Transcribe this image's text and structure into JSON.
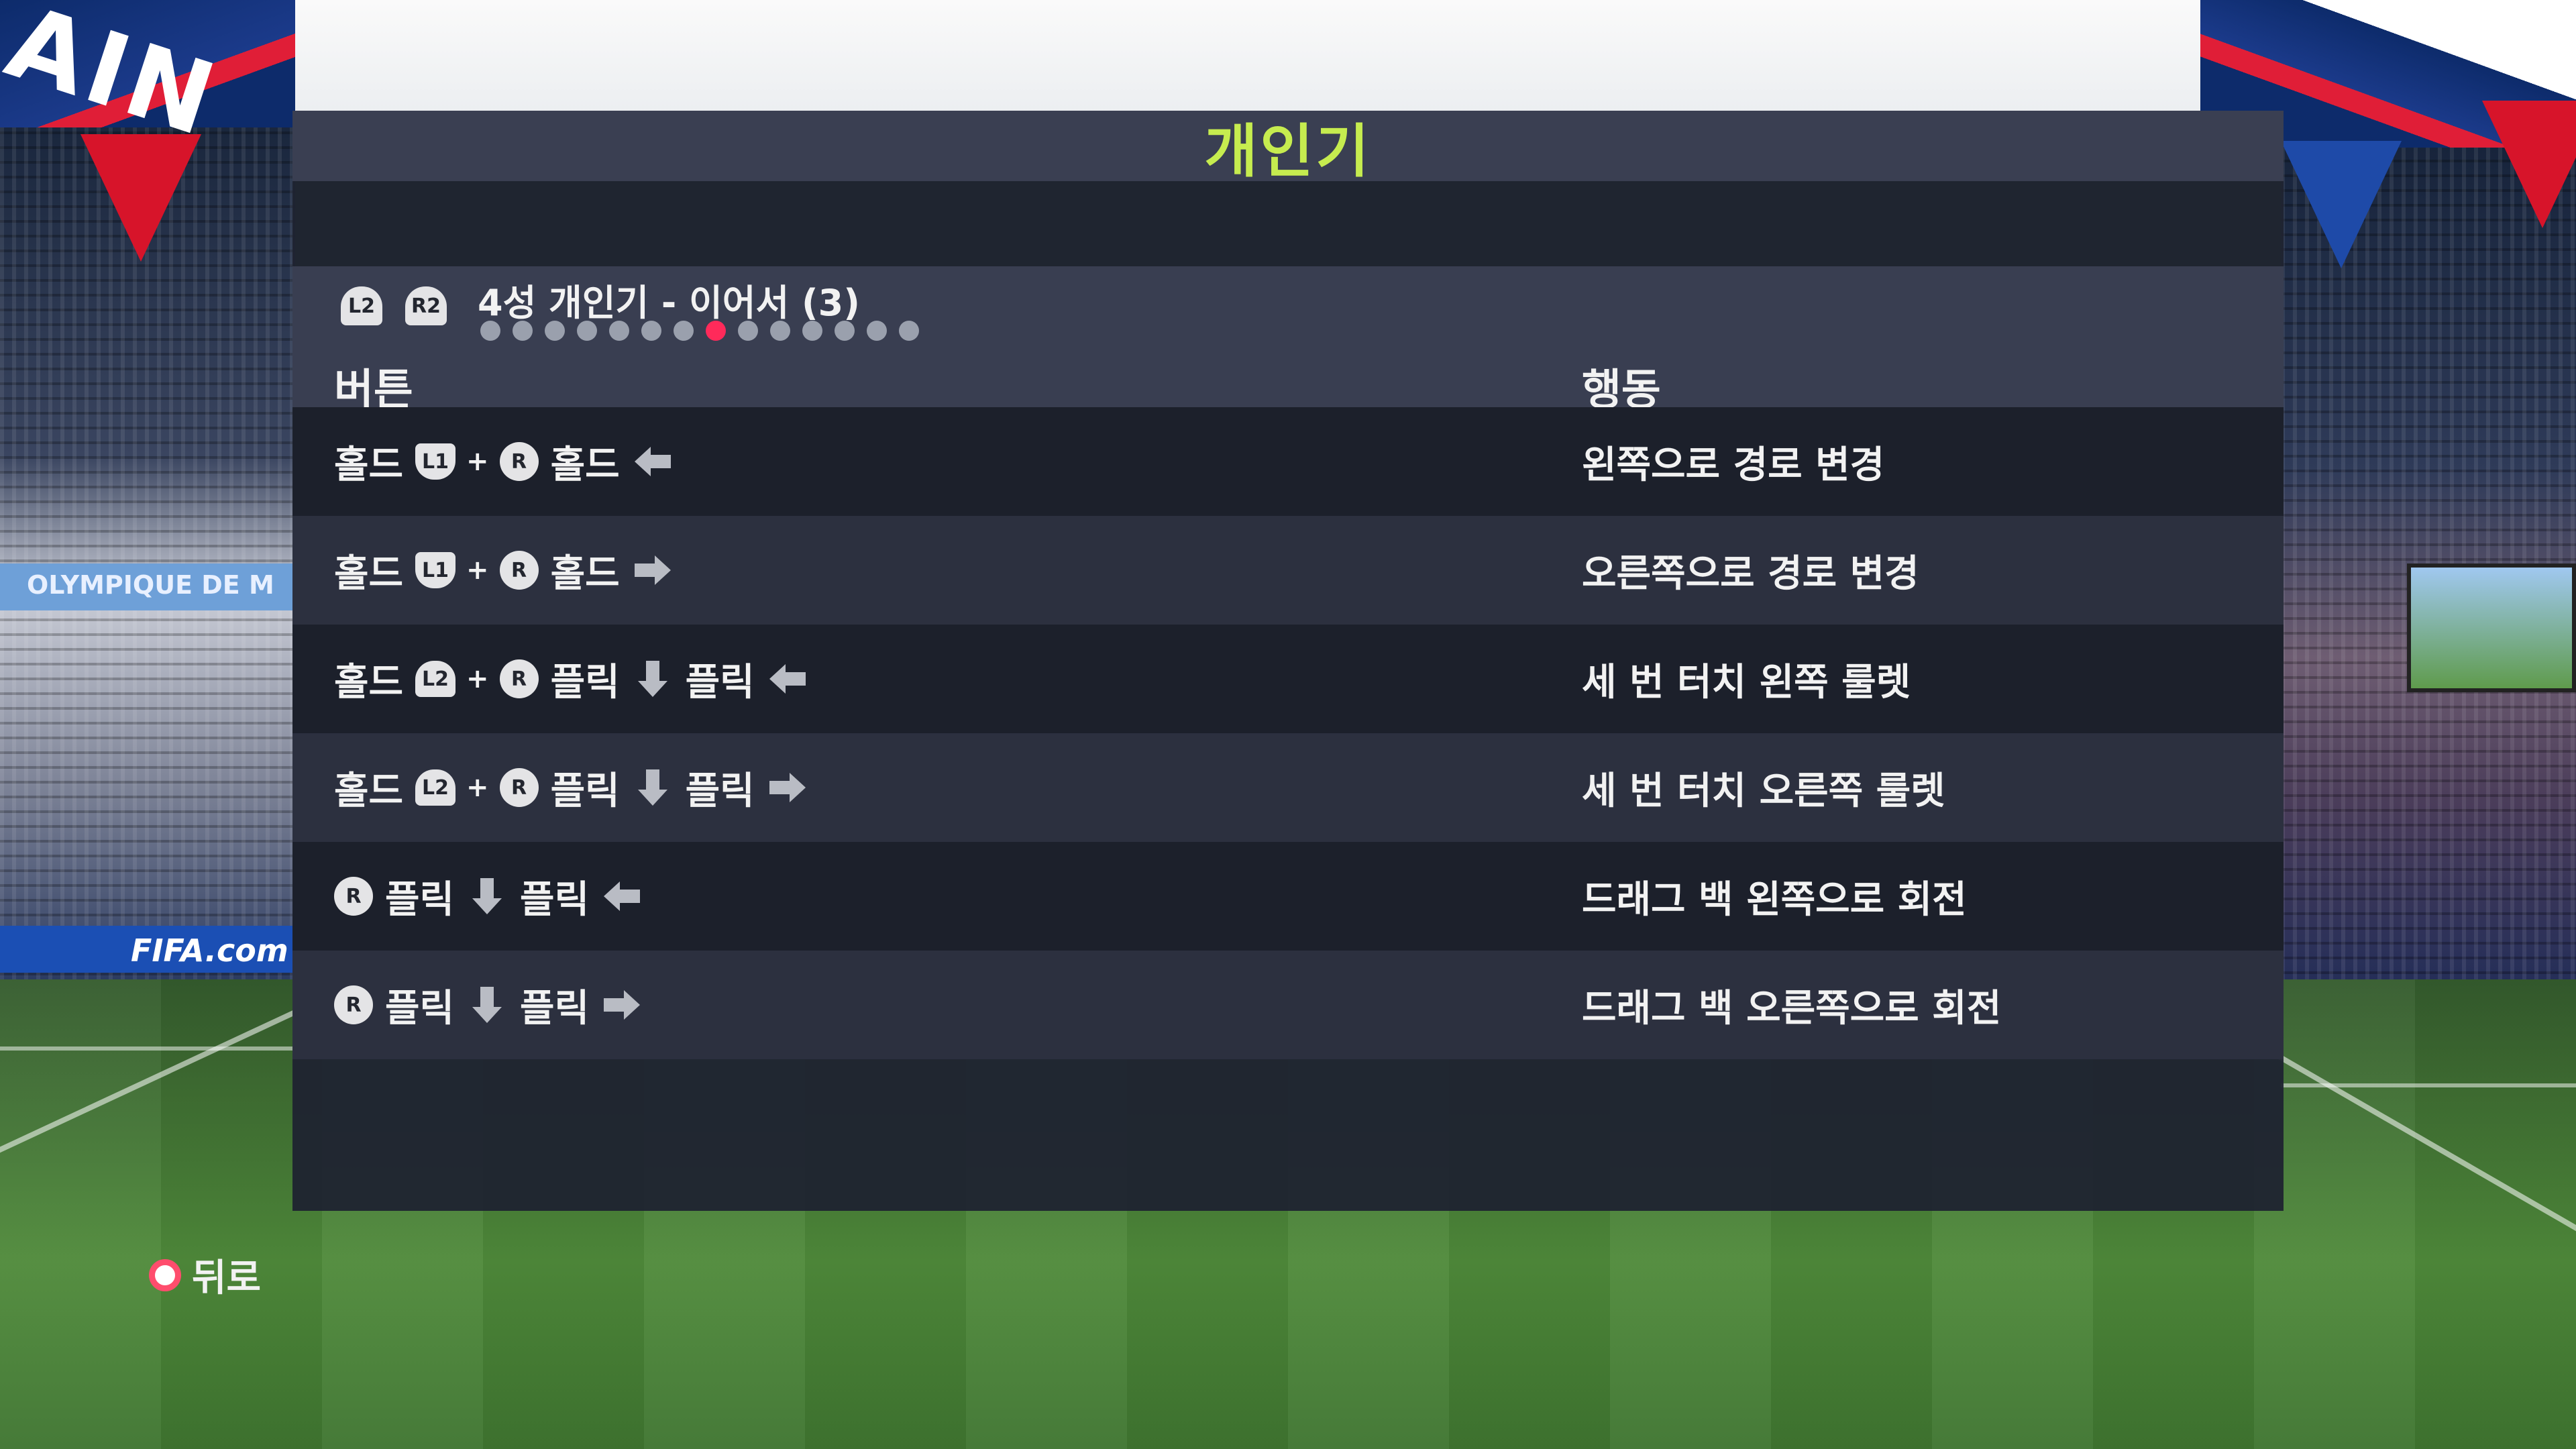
{
  "screen": {
    "title": "개인기",
    "title_color": "#c6ec4f",
    "skill_buttons": [
      "L2",
      "R2"
    ],
    "skill_name": "4성 개인기 - 이어서 (3)",
    "page_count": 14,
    "page_active_index": 7,
    "page_active_color": "#ff2a5a"
  },
  "columns": {
    "button": "버튼",
    "action": "행동"
  },
  "rows": [
    {
      "tokens": [
        {
          "t": "word",
          "v": "홀드"
        },
        {
          "t": "shoulder",
          "v": "L1"
        },
        {
          "t": "plus",
          "v": "+"
        },
        {
          "t": "stick",
          "v": "R"
        },
        {
          "t": "word",
          "v": "홀드"
        },
        {
          "t": "arrow",
          "v": "left"
        }
      ],
      "action": "왼쪽으로 경로 변경"
    },
    {
      "tokens": [
        {
          "t": "word",
          "v": "홀드"
        },
        {
          "t": "shoulder",
          "v": "L1"
        },
        {
          "t": "plus",
          "v": "+"
        },
        {
          "t": "stick",
          "v": "R"
        },
        {
          "t": "word",
          "v": "홀드"
        },
        {
          "t": "arrow",
          "v": "right"
        }
      ],
      "action": "오른쪽으로 경로 변경"
    },
    {
      "tokens": [
        {
          "t": "word",
          "v": "홀드"
        },
        {
          "t": "trigger",
          "v": "L2"
        },
        {
          "t": "plus",
          "v": "+"
        },
        {
          "t": "stick",
          "v": "R"
        },
        {
          "t": "word",
          "v": "플릭"
        },
        {
          "t": "arrow",
          "v": "down"
        },
        {
          "t": "word",
          "v": "플릭"
        },
        {
          "t": "arrow",
          "v": "left"
        }
      ],
      "action": "세 번 터치 왼쪽 룰렛"
    },
    {
      "tokens": [
        {
          "t": "word",
          "v": "홀드"
        },
        {
          "t": "trigger",
          "v": "L2"
        },
        {
          "t": "plus",
          "v": "+"
        },
        {
          "t": "stick",
          "v": "R"
        },
        {
          "t": "word",
          "v": "플릭"
        },
        {
          "t": "arrow",
          "v": "down"
        },
        {
          "t": "word",
          "v": "플릭"
        },
        {
          "t": "arrow",
          "v": "right"
        }
      ],
      "action": "세 번 터치 오른쪽 룰렛"
    },
    {
      "tokens": [
        {
          "t": "stick",
          "v": "R"
        },
        {
          "t": "word",
          "v": "플릭"
        },
        {
          "t": "arrow",
          "v": "down"
        },
        {
          "t": "word",
          "v": "플릭"
        },
        {
          "t": "arrow",
          "v": "left"
        }
      ],
      "action": "드래그 백 왼쪽으로 회전"
    },
    {
      "tokens": [
        {
          "t": "stick",
          "v": "R"
        },
        {
          "t": "word",
          "v": "플릭"
        },
        {
          "t": "arrow",
          "v": "down"
        },
        {
          "t": "word",
          "v": "플릭"
        },
        {
          "t": "arrow",
          "v": "right"
        }
      ],
      "action": "드래그 백 오른쪽으로 회전"
    }
  ],
  "footer": {
    "back_label": "뒤로",
    "back_icon": "circle-button-icon"
  },
  "background": {
    "banner_left_text": "AIN",
    "ad_left_text": "FIFA.com",
    "ad_mid_text": "OLYMPIQUE DE M"
  }
}
